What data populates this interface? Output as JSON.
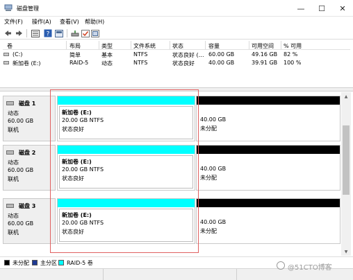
{
  "window": {
    "title": "磁盘管理",
    "controls": {
      "minimize": "—",
      "maximize": "☐",
      "close": "✕"
    }
  },
  "menu": [
    "文件(F)",
    "操作(A)",
    "查看(V)",
    "帮助(H)"
  ],
  "toolbar": [
    "back-arrow-icon",
    "forward-arrow-icon",
    "volume-list-icon",
    "help-icon",
    "volume-props-icon",
    "connect-icon",
    "check-icon",
    "settings-icon"
  ],
  "volume_list": {
    "columns": [
      "卷",
      "布局",
      "类型",
      "文件系统",
      "状态",
      "容量",
      "可用空间",
      "% 可用"
    ],
    "rows": [
      {
        "volume": "(C:)",
        "layout": "简单",
        "type": "基本",
        "fs": "NTFS",
        "status": "状态良好 (…",
        "capacity": "60.00 GB",
        "free": "49.16 GB",
        "pct": "82 %"
      },
      {
        "volume": "新加卷 (E:)",
        "layout": "RAID-5",
        "type": "动态",
        "fs": "NTFS",
        "status": "状态良好",
        "capacity": "40.00 GB",
        "free": "39.91 GB",
        "pct": "100 %"
      }
    ]
  },
  "disks": [
    {
      "name": "磁盘 1",
      "type": "动态",
      "size": "60.00 GB",
      "state": "联机",
      "partitions": [
        {
          "name": "新加卷 (E:)",
          "size": "20.00 GB NTFS",
          "status": "状态良好",
          "kind": "raid5"
        },
        {
          "size": "40.00 GB",
          "status": "未分配",
          "kind": "unallocated"
        }
      ]
    },
    {
      "name": "磁盘 2",
      "type": "动态",
      "size": "60.00 GB",
      "state": "联机",
      "partitions": [
        {
          "name": "新加卷 (E:)",
          "size": "20.00 GB NTFS",
          "status": "状态良好",
          "kind": "raid5"
        },
        {
          "size": "40.00 GB",
          "status": "未分配",
          "kind": "unallocated"
        }
      ]
    },
    {
      "name": "磁盘 3",
      "type": "动态",
      "size": "60.00 GB",
      "state": "联机",
      "partitions": [
        {
          "name": "新加卷 (E:)",
          "size": "20.00 GB NTFS",
          "status": "状态良好",
          "kind": "raid5"
        },
        {
          "size": "40.00 GB",
          "status": "未分配",
          "kind": "unallocated"
        }
      ]
    }
  ],
  "legend": [
    {
      "label": "未分配",
      "color": "#000000"
    },
    {
      "label": "主分区",
      "color": "#1f3a93"
    },
    {
      "label": "RAID-5 卷",
      "color": "#00ffff"
    }
  ],
  "colors": {
    "raid5": "#00ffff",
    "unallocated": "#000000",
    "highlight": "#e06060"
  },
  "watermark": "@51CTO博客"
}
